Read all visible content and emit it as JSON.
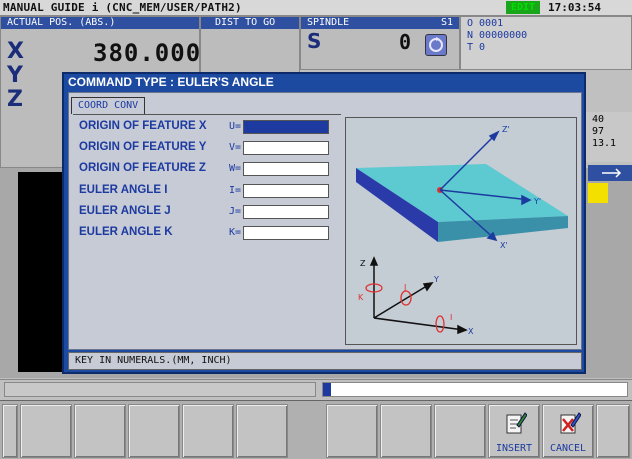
{
  "titlebar": {
    "title": "MANUAL GUIDE i  (CNC_MEM/USER/PATH2)",
    "mode": "EDIT",
    "clock": "17:03:54"
  },
  "header": {
    "actual_pos_label": "ACTUAL POS. (ABS.)",
    "dist_to_go_label": "DIST TO GO",
    "spindle_label": "SPINDLE",
    "spindle_id": "S1",
    "spindle_letter": "S",
    "spindle_value": "0",
    "axes": [
      "X",
      "Y",
      "Z"
    ],
    "x_value": "380.000",
    "o_line": "O 0001",
    "n_line": "N 00000000",
    "t_line": "T 0",
    "right_values": [
      "40",
      "97",
      "13.1"
    ]
  },
  "dialog": {
    "title": "COMMAND TYPE : EULER'S ANGLE",
    "tab_label": "COORD CONV",
    "fields": [
      {
        "label": "ORIGIN OF FEATURE X",
        "letter": "U=",
        "value": ""
      },
      {
        "label": "ORIGIN OF FEATURE Y",
        "letter": "V=",
        "value": ""
      },
      {
        "label": "ORIGIN OF FEATURE Z",
        "letter": "W=",
        "value": ""
      },
      {
        "label": "EULER ANGLE I",
        "letter": "I=",
        "value": ""
      },
      {
        "label": "EULER ANGLE J",
        "letter": "J=",
        "value": ""
      },
      {
        "label": "EULER ANGLE K",
        "letter": "K=",
        "value": ""
      }
    ],
    "figure_labels": {
      "z_prime": "Z'",
      "y_prime": "Y'",
      "x_prime": "X'",
      "z": "Z",
      "y": "Y",
      "x": "X",
      "k": "K",
      "j": "J",
      "i": "I"
    },
    "status_message": "KEY IN NUMERALS.(MM, INCH)"
  },
  "softkeys": {
    "insert_label": "INSERT",
    "cancel_label": "CANCEL"
  },
  "colors": {
    "dialog_blue": "#1c4aa0",
    "plane_cyan": "#5ccad0",
    "edit_green": "#1aa61a"
  }
}
